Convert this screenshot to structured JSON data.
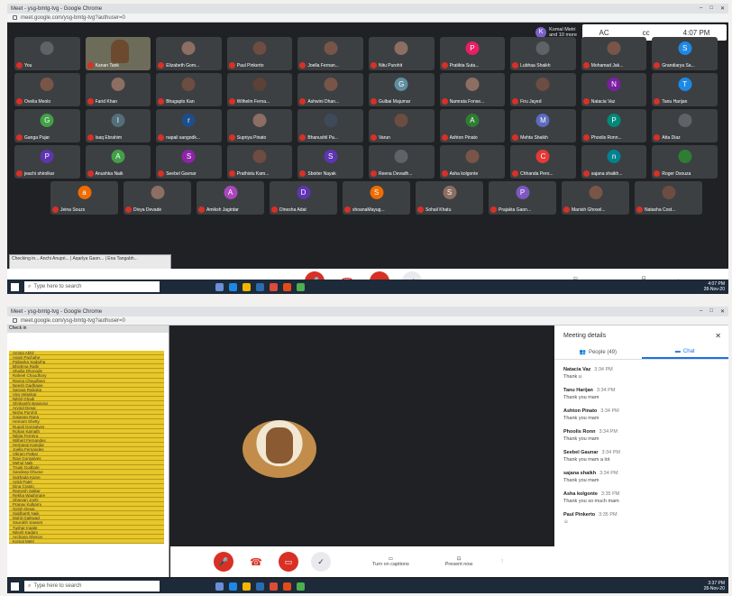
{
  "window_title": "Meet - ysg-bmtg-tvg - Google Chrome",
  "window_controls": [
    "–",
    "□",
    "✕"
  ],
  "url": "meet.google.com/ysg-bmtg-tvg?authuser=0",
  "join_notice": {
    "initial": "K",
    "line1": "Komal Metri",
    "line2": "and 10 more"
  },
  "system_strip": {
    "icon1": "AC",
    "icon2": "cc",
    "time": "4:07 PM"
  },
  "participants_rows": [
    [
      {
        "name": "You",
        "initial": "",
        "color": "#5f6368",
        "video": false
      },
      {
        "name": "Kanan Tank",
        "initial": "",
        "color": "#6b4a2f",
        "video": true
      },
      {
        "name": "Elizabeth Gom...",
        "initial": "",
        "color": "#8d6e63",
        "video": false
      },
      {
        "name": "Paul Pinkerto",
        "initial": "",
        "color": "#6d4c41",
        "video": false
      },
      {
        "name": "Joella Fernan...",
        "initial": "",
        "color": "#795548",
        "video": false
      },
      {
        "name": "Nitu Purohit",
        "initial": "",
        "color": "#8d6e63",
        "video": false
      },
      {
        "name": "Pratikta Suta...",
        "initial": "P",
        "color": "#e91e63",
        "video": false
      },
      {
        "name": "Lubhaa Shaikh",
        "initial": "",
        "color": "#5f6368",
        "video": false
      },
      {
        "name": "Mohamad Jak...",
        "initial": "",
        "color": "#795548",
        "video": false
      },
      {
        "name": "Grandiarya Sa...",
        "initial": "S",
        "color": "#1e88e5",
        "video": false
      }
    ],
    [
      {
        "name": "Ovelia Meolo",
        "initial": "",
        "color": "#795548",
        "video": false
      },
      {
        "name": "Farid Khan",
        "initial": "",
        "color": "#8d6e63",
        "video": false
      },
      {
        "name": "Bhagapts Kan",
        "initial": "",
        "color": "#6d4c41",
        "video": false
      },
      {
        "name": "Wilhelm Ferna...",
        "initial": "",
        "color": "#5d4037",
        "video": false
      },
      {
        "name": "Ashwini Dhan...",
        "initial": "",
        "color": "#795548",
        "video": false
      },
      {
        "name": "Gulbai Majumar",
        "initial": "G",
        "color": "#5f8ea0",
        "video": false
      },
      {
        "name": "Namrata Fonse...",
        "initial": "",
        "color": "#8d6e63",
        "video": false
      },
      {
        "name": "Firu Jayed",
        "initial": "",
        "color": "#6d4c41",
        "video": false
      },
      {
        "name": "Natacia Vaz",
        "initial": "N",
        "color": "#7b1fa2",
        "video": false
      },
      {
        "name": "Tanu Harijan",
        "initial": "T",
        "color": "#1e88e5",
        "video": false
      }
    ],
    [
      {
        "name": "Ganga Pujar",
        "initial": "G",
        "color": "#43a047",
        "video": false
      },
      {
        "name": "Isaq Ebrahim",
        "initial": "I",
        "color": "#546e7a",
        "video": false
      },
      {
        "name": "napali sangodk...",
        "initial": "r",
        "color": "#1e4d8a",
        "video": false
      },
      {
        "name": "Supriya Pinato",
        "initial": "",
        "color": "#8d6e63",
        "video": false
      },
      {
        "name": "Bhanushil Pa...",
        "initial": "",
        "color": "#3e4a5a",
        "video": false
      },
      {
        "name": "Varun",
        "initial": "",
        "color": "#6d4c41",
        "video": false
      },
      {
        "name": "Ashton Pinato",
        "initial": "A",
        "color": "#2e7d32",
        "video": false
      },
      {
        "name": "Mehta Shaikh",
        "initial": "M",
        "color": "#5c6bc0",
        "video": false
      },
      {
        "name": "Phoolis Ronn...",
        "initial": "P",
        "color": "#00897b",
        "video": false
      },
      {
        "name": "Atta Diaz",
        "initial": "",
        "color": "#5f6368",
        "video": false
      }
    ],
    [
      {
        "name": "jeachi shirolkar",
        "initial": "P",
        "color": "#5e35b1",
        "video": false
      },
      {
        "name": "Anushka Naik",
        "initial": "A",
        "color": "#43a047",
        "video": false
      },
      {
        "name": "Seebel Gavnar",
        "initial": "S",
        "color": "#8e24aa",
        "video": false
      },
      {
        "name": "Prathistu Kam...",
        "initial": "",
        "color": "#6d4c41",
        "video": false
      },
      {
        "name": "Sboiter Nayak",
        "initial": "S",
        "color": "#5e35b1",
        "video": false
      },
      {
        "name": "Reena Devadh...",
        "initial": "",
        "color": "#5f6368",
        "video": false
      },
      {
        "name": "Asha kolgonte",
        "initial": "",
        "color": "#795548",
        "video": false
      },
      {
        "name": "Chhanda Pero...",
        "initial": "C",
        "color": "#e53935",
        "video": false
      },
      {
        "name": "sajana shaikh...",
        "initial": "n",
        "color": "#00838f",
        "video": false
      },
      {
        "name": "Roger Dsouza",
        "initial": "",
        "color": "#2e7d32",
        "video": false
      }
    ]
  ],
  "participants_last_row": [
    {
      "name": "Jeina Souzs",
      "initial": "a",
      "color": "#ef6c00"
    },
    {
      "name": "Divya Devade",
      "initial": "",
      "color": "#8d6e63"
    },
    {
      "name": "Amiksh Jagirdar",
      "initial": "A",
      "color": "#ab47bc"
    },
    {
      "name": "Dinesha Adat",
      "initial": "D",
      "color": "#5e35b1"
    },
    {
      "name": "shoanaMayug...",
      "initial": "S",
      "color": "#ef6c00"
    },
    {
      "name": "Sohail Khatu",
      "initial": "S",
      "color": "#8d6e63"
    },
    {
      "name": "Prajakta Gaon...",
      "initial": "P",
      "color": "#7e57c2"
    },
    {
      "name": "Manish Ghosel...",
      "initial": "",
      "color": "#795548"
    },
    {
      "name": "Natasha Cost...",
      "initial": "",
      "color": "#6d4c41"
    }
  ],
  "controls": {
    "captions_label": "Turn on captions",
    "present_label": "Present now"
  },
  "overlay_text": "Checking in... Anchi Anupri... | Aqarlya Gaon... | Ena Tangabh...",
  "taskbar": {
    "search_placeholder": "Type here to search",
    "time": "4:07 PM",
    "date": "28-Nov-20"
  },
  "taskbar2": {
    "time": "3:37 PM",
    "date": "28-Nov-20"
  },
  "sheet": {
    "title": "Check in",
    "names": [
      "Amina Akhil",
      "Avani Pachahe",
      "Pallavika Sadarha",
      "Bhishma Rathi",
      "Shailja Dhongde",
      "Raheel Chaudhary",
      "Rayna Chaudhary",
      "Neesh Gadhawe",
      "Sarupa Rajkotia",
      "Vira Velankar",
      "Nikhil Ghadi",
      "Shrikanthi Basavraj",
      "Arvind Desai",
      "Nisha Purohit",
      "Gajanan Rana",
      "Hemant Shetty",
      "Rupali Gonsalves",
      "Rohan Kamath",
      "Nikita Ferreira",
      "Wilbert Fernandes",
      "Hemangi Kamdar",
      "Joella Fernandes",
      "Vikram Patkar",
      "Ravi Gonsalves",
      "Mehul Naik",
      "Trupti Godbole",
      "Sandeep Dhume",
      "Sukhada Karve",
      "Ankit Patel",
      "Dina Crasto",
      "Ramesh Salkar",
      "Rekha Waghmare",
      "Sharvari Joshi",
      "Pranav Kulkarni",
      "Girish Desai",
      "Siddharth Naik",
      "Mohit Gaikwad",
      "Saurabh Sawant",
      "Tushar Ingale",
      "Nilesh Kadam",
      "Archana Shenoy",
      "Komal Metri"
    ]
  },
  "panel": {
    "title": "Meeting details",
    "people_tab": "People (49)",
    "chat_tab": "Chat",
    "messages": [
      {
        "who": "Natacia Vaz",
        "when": "3:34 PM",
        "text": "Thank u"
      },
      {
        "who": "Tanu Harijan",
        "when": "3:34 PM",
        "text": "Thank you mam"
      },
      {
        "who": "Ashton Pinato",
        "when": "3:34 PM",
        "text": "Thank you mam"
      },
      {
        "who": "Phoolis Ronn",
        "when": "3:34 PM",
        "text": "Thank you mam"
      },
      {
        "who": "Seebel Gaunar",
        "when": "3:34 PM",
        "text": "Thank you mam a lot"
      },
      {
        "who": "sajana shaikh",
        "when": "3:34 PM",
        "text": "Thank you mam"
      },
      {
        "who": "Asha kolgonte",
        "when": "3:35 PM",
        "text": "Thank you so much mam"
      },
      {
        "who": "Paul Pinkerto",
        "when": "3:35 PM",
        "text": "☺"
      }
    ]
  }
}
